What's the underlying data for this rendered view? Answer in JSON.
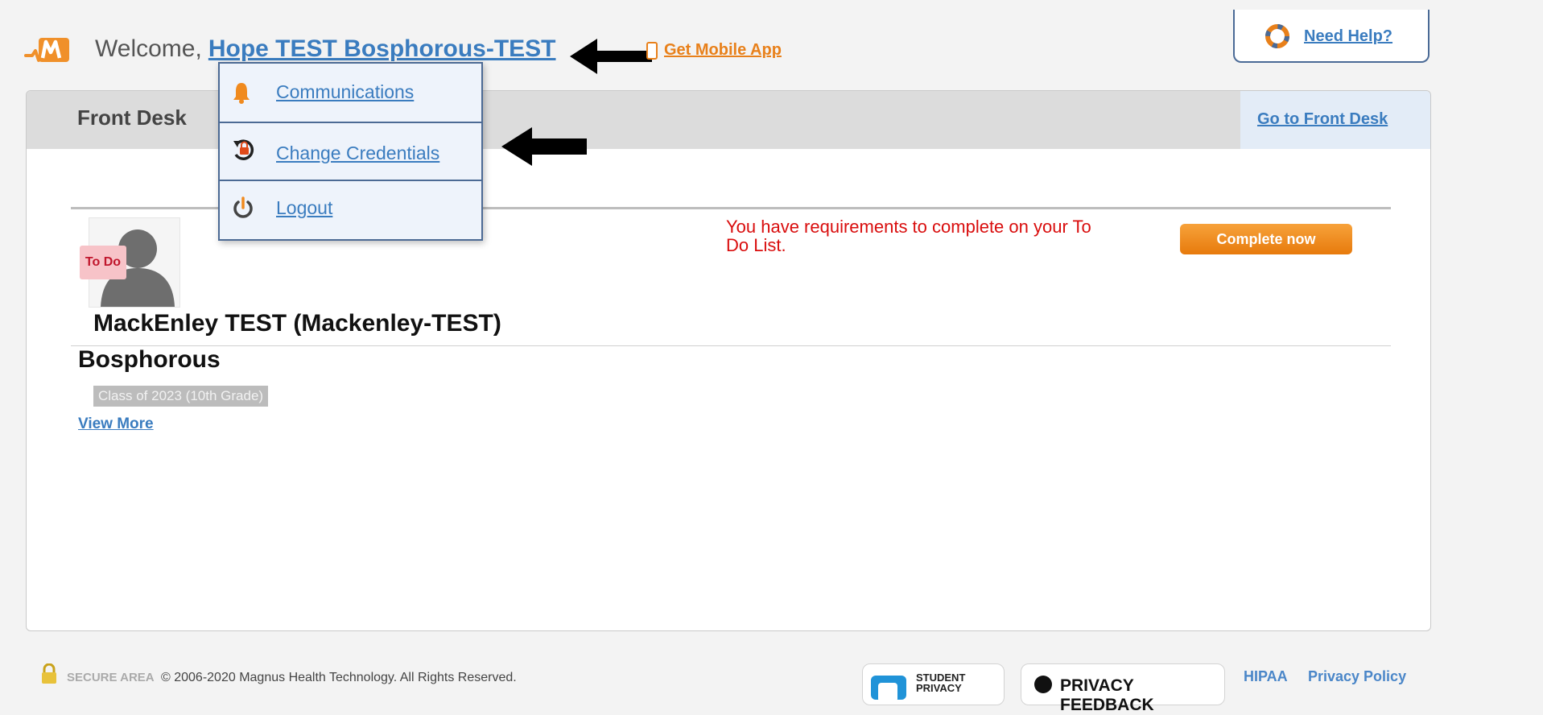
{
  "header": {
    "welcome_text": "Welcome,",
    "user_name": "Hope TEST Bosphorous-TEST",
    "mobile_app_label": "Get Mobile App",
    "help_label": "Need Help?"
  },
  "user_menu": {
    "items": [
      {
        "label": "Communications",
        "icon": "bell-icon"
      },
      {
        "label": "Change Credentials",
        "icon": "credentials-icon"
      },
      {
        "label": "Logout",
        "icon": "power-icon"
      }
    ]
  },
  "panel": {
    "title": "Front Desk",
    "goto_label": "Go to Front Desk"
  },
  "student": {
    "todo_badge": "To Do",
    "requirements_message": "You have requirements to complete on your To Do List.",
    "complete_button": "Complete now",
    "name_line": "MackEnley TEST (Mackenley-TEST)",
    "school_line": "Bosphorous",
    "class_badge": "Class of 2023 (10th Grade)",
    "view_more": "View More"
  },
  "footer": {
    "secure_area": "SECURE AREA",
    "copyright": "© 2006-2020 Magnus Health Technology. All Rights Reserved.",
    "student_privacy_line1": "STUDENT",
    "student_privacy_line2": "PRIVACY",
    "privacy_feedback": "PRIVACY FEEDBACK",
    "hipaa": "HIPAA",
    "privacy_policy": "Privacy Policy"
  },
  "colors": {
    "link": "#3a7cbf",
    "accent_orange": "#e8801a",
    "warning_red": "#d90d0d",
    "menu_border": "#4c6a94"
  }
}
